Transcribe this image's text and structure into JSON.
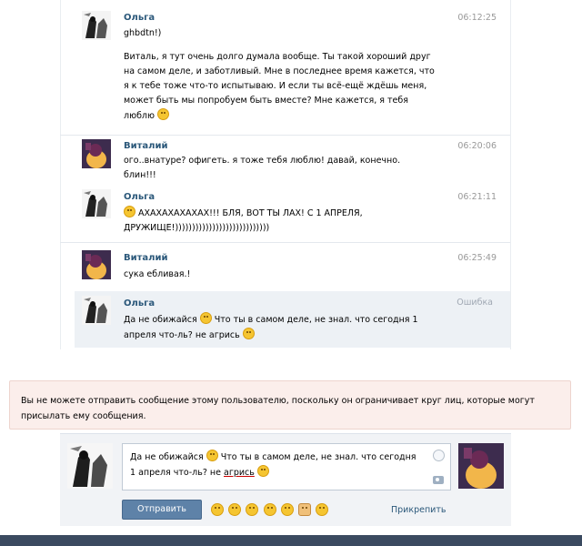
{
  "messages": [
    {
      "author": "Ольга",
      "time": "06:12:25",
      "lines": [
        "ghbdtn!)",
        "",
        "Виталь, я тут очень долго думала вообще. Ты такой хороший друг",
        "на самом деле, и заботливый. Мне в последнее время кажется, что",
        "я к тебе тоже что-то испытываю. И если ты всё-ещё ждёшь меня,",
        "может быть мы попробуем быть вместе? Мне кажется, я тебя",
        "люблю"
      ]
    },
    {
      "author": "Виталий",
      "time": "06:20:06",
      "lines": [
        "ого..внатуре? офигеть. я тоже тебя люблю! давай, конечно.",
        "блин!!!"
      ]
    },
    {
      "author": "Ольга",
      "time": "06:21:11",
      "lines": [
        "АХАХАХАХАХАХ!!! БЛЯ, ВОТ ТЫ ЛАХ! С 1 АПРЕЛЯ,",
        "ДРУЖИЩЕ!))))))))))))))))))))))))))))"
      ]
    },
    {
      "author": "Виталий",
      "time": "06:25:49",
      "lines": [
        "сука ебливая.!"
      ]
    },
    {
      "author": "Ольга",
      "time": "Ошибка",
      "lines": [
        "Да не обижайся",
        "Что ты в самом деле, не знал. что сегодня 1",
        "апреля что-ль? не агрись"
      ]
    }
  ],
  "notice": "Вы не можете отправить сообщение этому пользователю, поскольку он ограничивает круг лиц, которые могут присылать ему сообщения.",
  "compose": {
    "line1_a": "Да не обижайся",
    "line1_b": "Что ты в самом деле, не знал. что сегодня",
    "line2_a": "1 апреля что-ль? не",
    "line2_b": "агрись",
    "send_label": "Отправить",
    "attach_label": "Прикрепить"
  },
  "emoji_bar": [
    "smile",
    "sad",
    "laugh",
    "neutral",
    "grin",
    "thumbs-up",
    "kiss"
  ],
  "colors": {
    "link": "#2b587a",
    "button": "#5e82a8",
    "notice_bg": "#fbeeeb",
    "highlight_bg": "#edf1f5"
  }
}
